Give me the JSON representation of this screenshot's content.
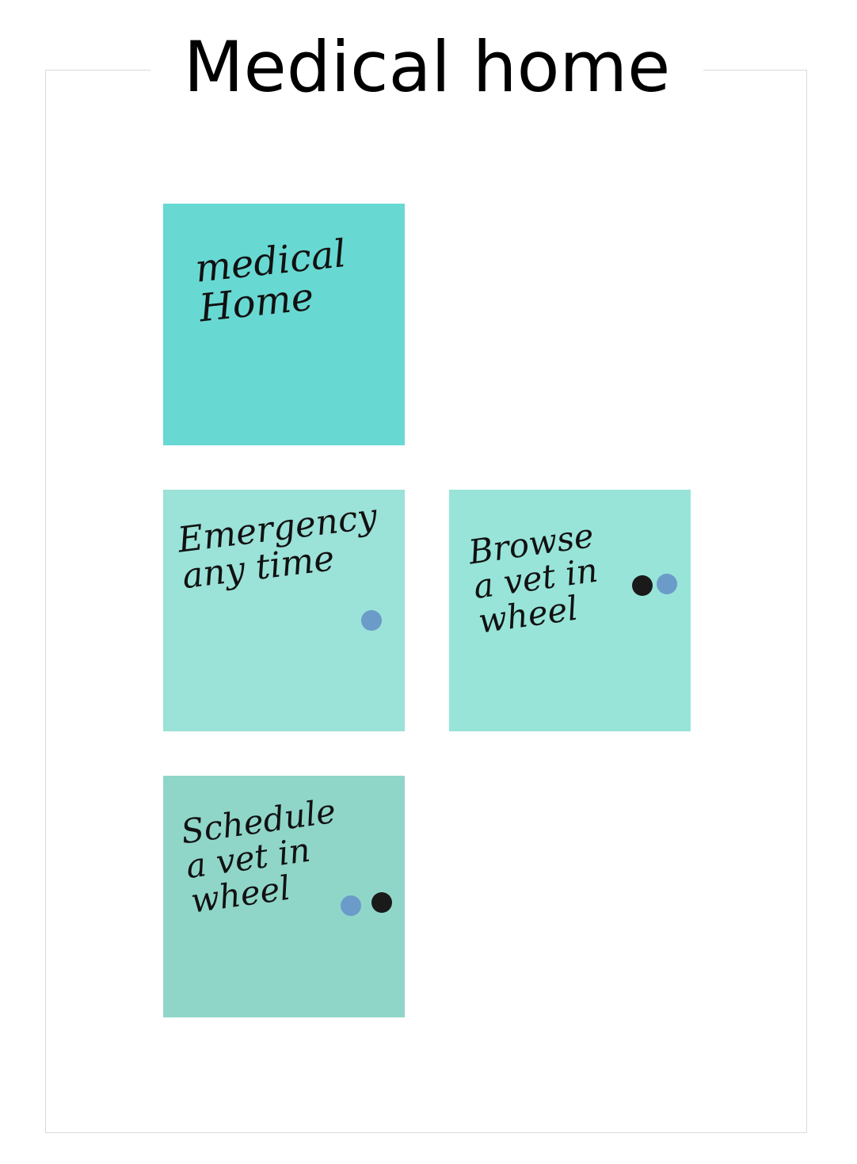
{
  "page": {
    "title": "Medical home"
  },
  "notes": [
    {
      "text": "medical\nHome",
      "color": "#68d8d3",
      "dots": []
    },
    {
      "text": "Emergency\nany time",
      "color": "#9be2d8",
      "dots": [
        "#6b9bc9"
      ]
    },
    {
      "text": "Browse\na vet in\nwheel",
      "color": "#98e4d9",
      "dots": [
        "#1a1a1a",
        "#6b9bc9"
      ]
    },
    {
      "text": "Schedule\na vet in\nwheel",
      "color": "#8fd6c9",
      "dots": [
        "#6b9bc9",
        "#1a1a1a"
      ]
    }
  ]
}
